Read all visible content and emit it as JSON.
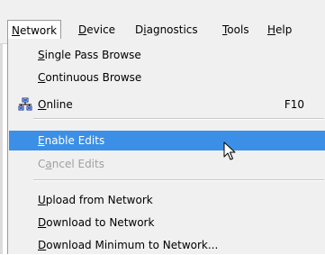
{
  "menubar": {
    "items": [
      {
        "pre": "",
        "mn": "N",
        "post": "etwork"
      },
      {
        "pre": "",
        "mn": "D",
        "post": "evice"
      },
      {
        "pre": "D",
        "mn": "i",
        "post": "agnostics"
      },
      {
        "pre": "",
        "mn": "T",
        "post": "ools"
      },
      {
        "pre": "",
        "mn": "H",
        "post": "elp"
      }
    ]
  },
  "menu": {
    "items": [
      {
        "pre": "",
        "mn": "S",
        "post": "ingle Pass Browse",
        "shortcut": ""
      },
      {
        "pre": "",
        "mn": "C",
        "post": "ontinuous Browse",
        "shortcut": ""
      },
      {
        "pre": "",
        "mn": "O",
        "post": "nline",
        "shortcut": "F10",
        "icon": "network-icon"
      },
      {
        "pre": "",
        "mn": "E",
        "post": "nable Edits",
        "shortcut": ""
      },
      {
        "pre": "C",
        "mn": "a",
        "post": "ncel Edits",
        "shortcut": ""
      },
      {
        "pre": "",
        "mn": "U",
        "post": "pload from Network",
        "shortcut": ""
      },
      {
        "pre": "",
        "mn": "D",
        "post": "ownload to Network",
        "shortcut": ""
      },
      {
        "pre": "",
        "mn": "D",
        "post": "ownload Minimum to Network...",
        "shortcut": ""
      }
    ]
  },
  "colors": {
    "highlight": "#3b8fe6",
    "disabled_text": "#a0a0a0"
  }
}
